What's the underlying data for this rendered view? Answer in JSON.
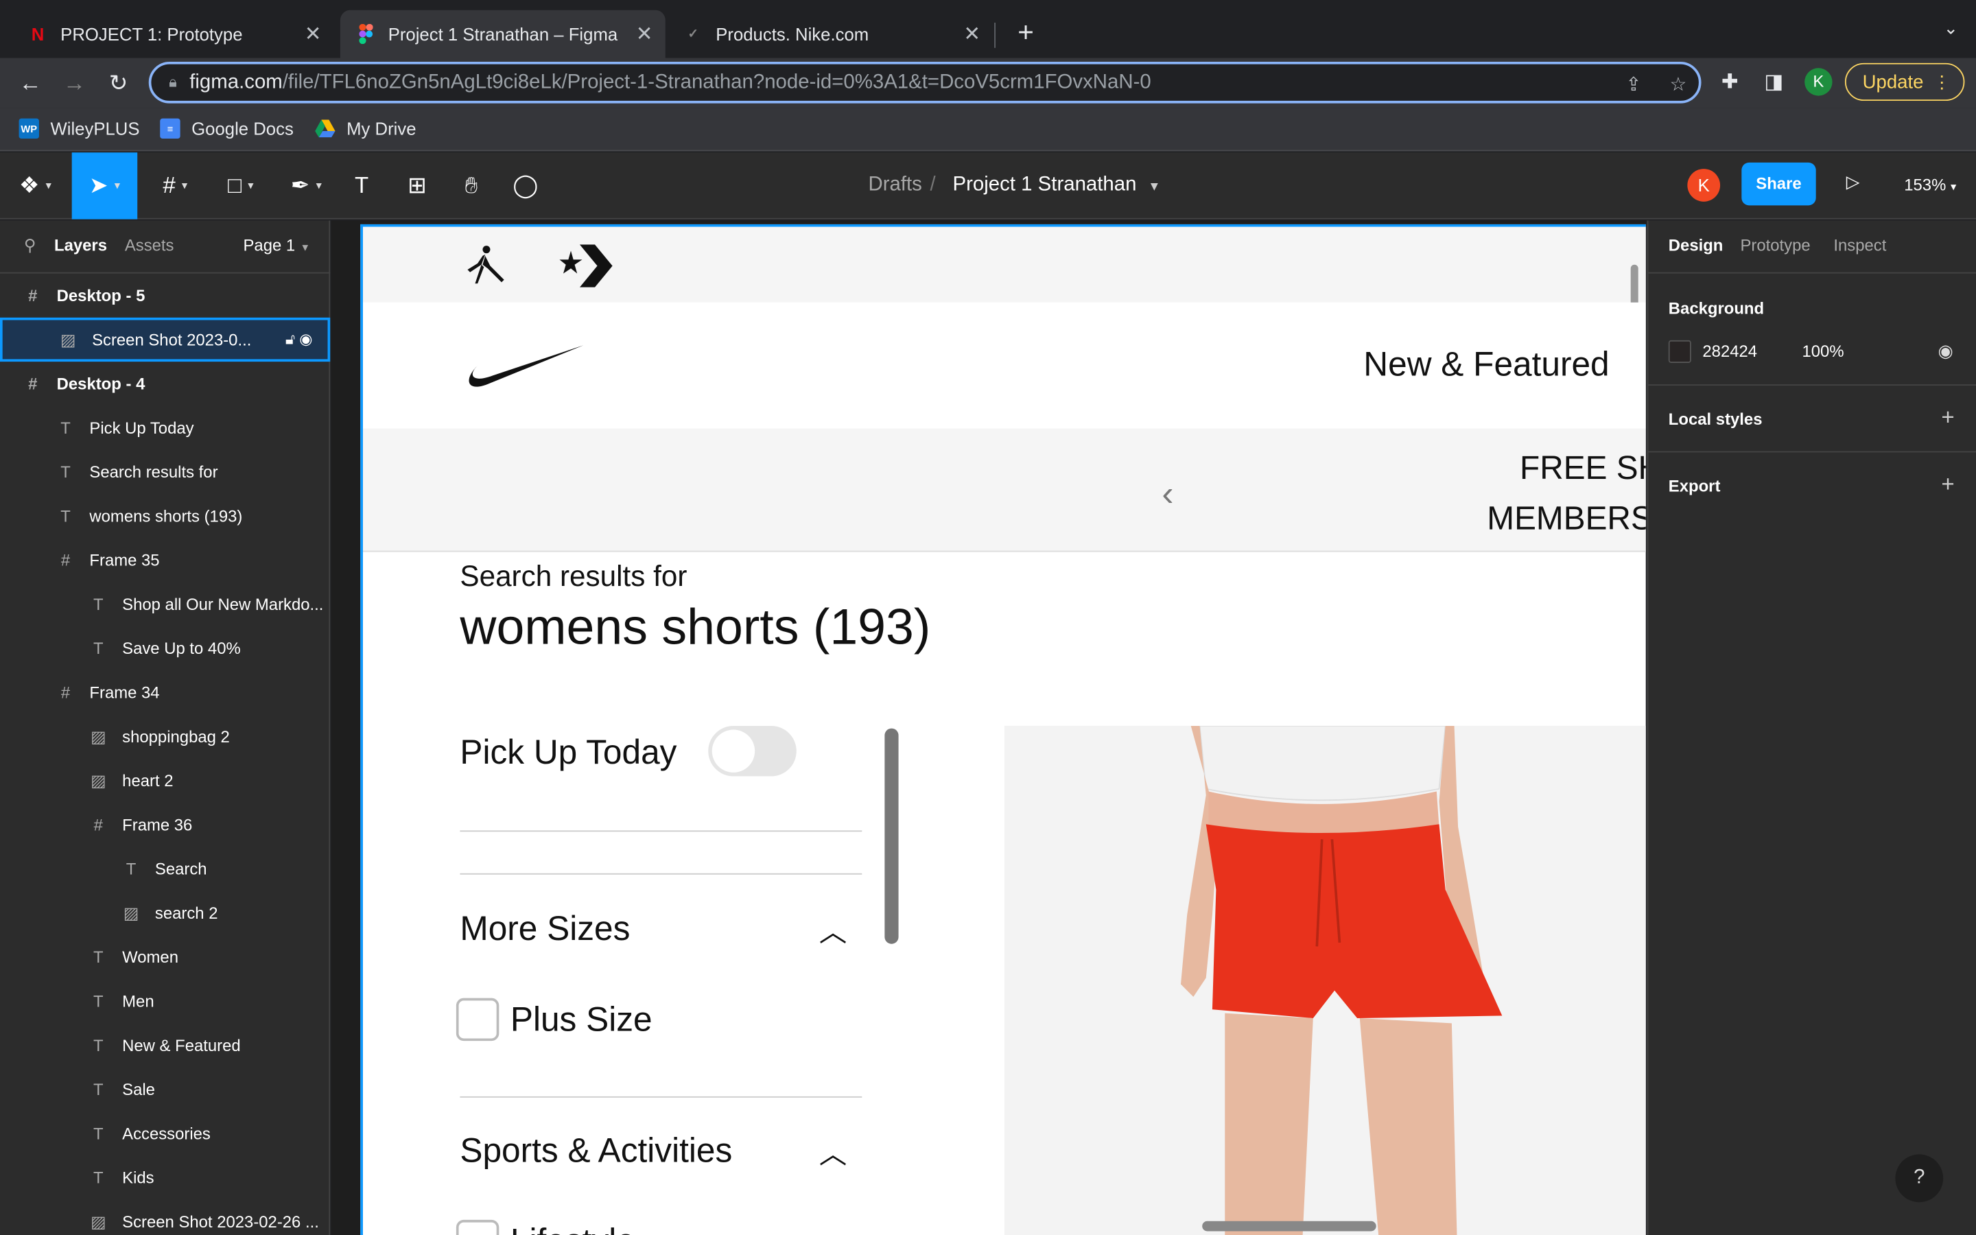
{
  "browser": {
    "tabs": [
      {
        "title": "PROJECT 1: Prototype",
        "favicon": "N"
      },
      {
        "title": "Project 1 Stranathan – Figma",
        "favicon": "figma"
      },
      {
        "title": "Products. Nike.com",
        "favicon": "nike"
      }
    ],
    "url_host": "figma.com",
    "url_path": "/file/TFL6noZGn5nAgLt9ci8eLk/Project-1-Stranathan?node-id=0%3A1&t=DcoV5crm1FOvxNaN-0",
    "profile_initial": "K",
    "update_label": "Update",
    "bookmarks": [
      {
        "label": "WileyPLUS",
        "icon": "WP"
      },
      {
        "label": "Google Docs"
      },
      {
        "label": "My Drive"
      }
    ]
  },
  "figma": {
    "breadcrumb_parent": "Drafts",
    "breadcrumb_sep": "/",
    "file_title": "Project 1 Stranathan",
    "avatar_initial": "K",
    "share_label": "Share",
    "zoom": "153%",
    "left": {
      "tab_layers": "Layers",
      "tab_assets": "Assets",
      "page": "Page 1",
      "layers": [
        {
          "name": "Desktop - 5",
          "icon": "#",
          "indent": 0,
          "bold": true
        },
        {
          "name": "Screen Shot 2023-0...",
          "icon": "image",
          "indent": 1,
          "selected": true
        },
        {
          "name": "Desktop - 4",
          "icon": "#",
          "indent": 0,
          "bold": true
        },
        {
          "name": "Pick Up Today",
          "icon": "T",
          "indent": 1
        },
        {
          "name": "Search results for",
          "icon": "T",
          "indent": 1
        },
        {
          "name": "womens shorts (193)",
          "icon": "T",
          "indent": 1
        },
        {
          "name": "Frame 35",
          "icon": "#",
          "indent": 1
        },
        {
          "name": "Shop all Our New Markdo...",
          "icon": "T",
          "indent": 2
        },
        {
          "name": "Save Up to 40%",
          "icon": "T",
          "indent": 2
        },
        {
          "name": "Frame 34",
          "icon": "#",
          "indent": 1
        },
        {
          "name": "shoppingbag 2",
          "icon": "image",
          "indent": 2
        },
        {
          "name": "heart 2",
          "icon": "image",
          "indent": 2
        },
        {
          "name": "Frame 36",
          "icon": "#",
          "indent": 2
        },
        {
          "name": "Search",
          "icon": "T",
          "indent": 3
        },
        {
          "name": "search 2",
          "icon": "image",
          "indent": 3
        },
        {
          "name": "Women",
          "icon": "T",
          "indent": 2
        },
        {
          "name": "Men",
          "icon": "T",
          "indent": 2
        },
        {
          "name": "New & Featured",
          "icon": "T",
          "indent": 2
        },
        {
          "name": "Sale",
          "icon": "T",
          "indent": 2
        },
        {
          "name": "Accessories",
          "icon": "T",
          "indent": 2
        },
        {
          "name": "Kids",
          "icon": "T",
          "indent": 2
        },
        {
          "name": "Screen Shot 2023-02-26 ...",
          "icon": "image",
          "indent": 2
        }
      ]
    },
    "canvas": {
      "nav_label": "New & Featured",
      "banner_line1": "FREE SH",
      "banner_line2": "MEMBERS",
      "search_for": "Search results for",
      "search_title": "womens shorts (193)",
      "pickup": "Pick Up Today",
      "more_sizes": "More Sizes",
      "plus_size": "Plus Size",
      "sports": "Sports & Activities",
      "lifestyle": "Lifestyle"
    },
    "right": {
      "tab_design": "Design",
      "tab_prototype": "Prototype",
      "tab_inspect": "Inspect",
      "background_label": "Background",
      "bg_hex": "282424",
      "bg_opacity": "100%",
      "local_styles": "Local styles",
      "export": "Export",
      "help": "?"
    }
  },
  "colors": {
    "accent": "#0d99ff",
    "swatch": "#282424",
    "shorts": "#e8321c"
  }
}
